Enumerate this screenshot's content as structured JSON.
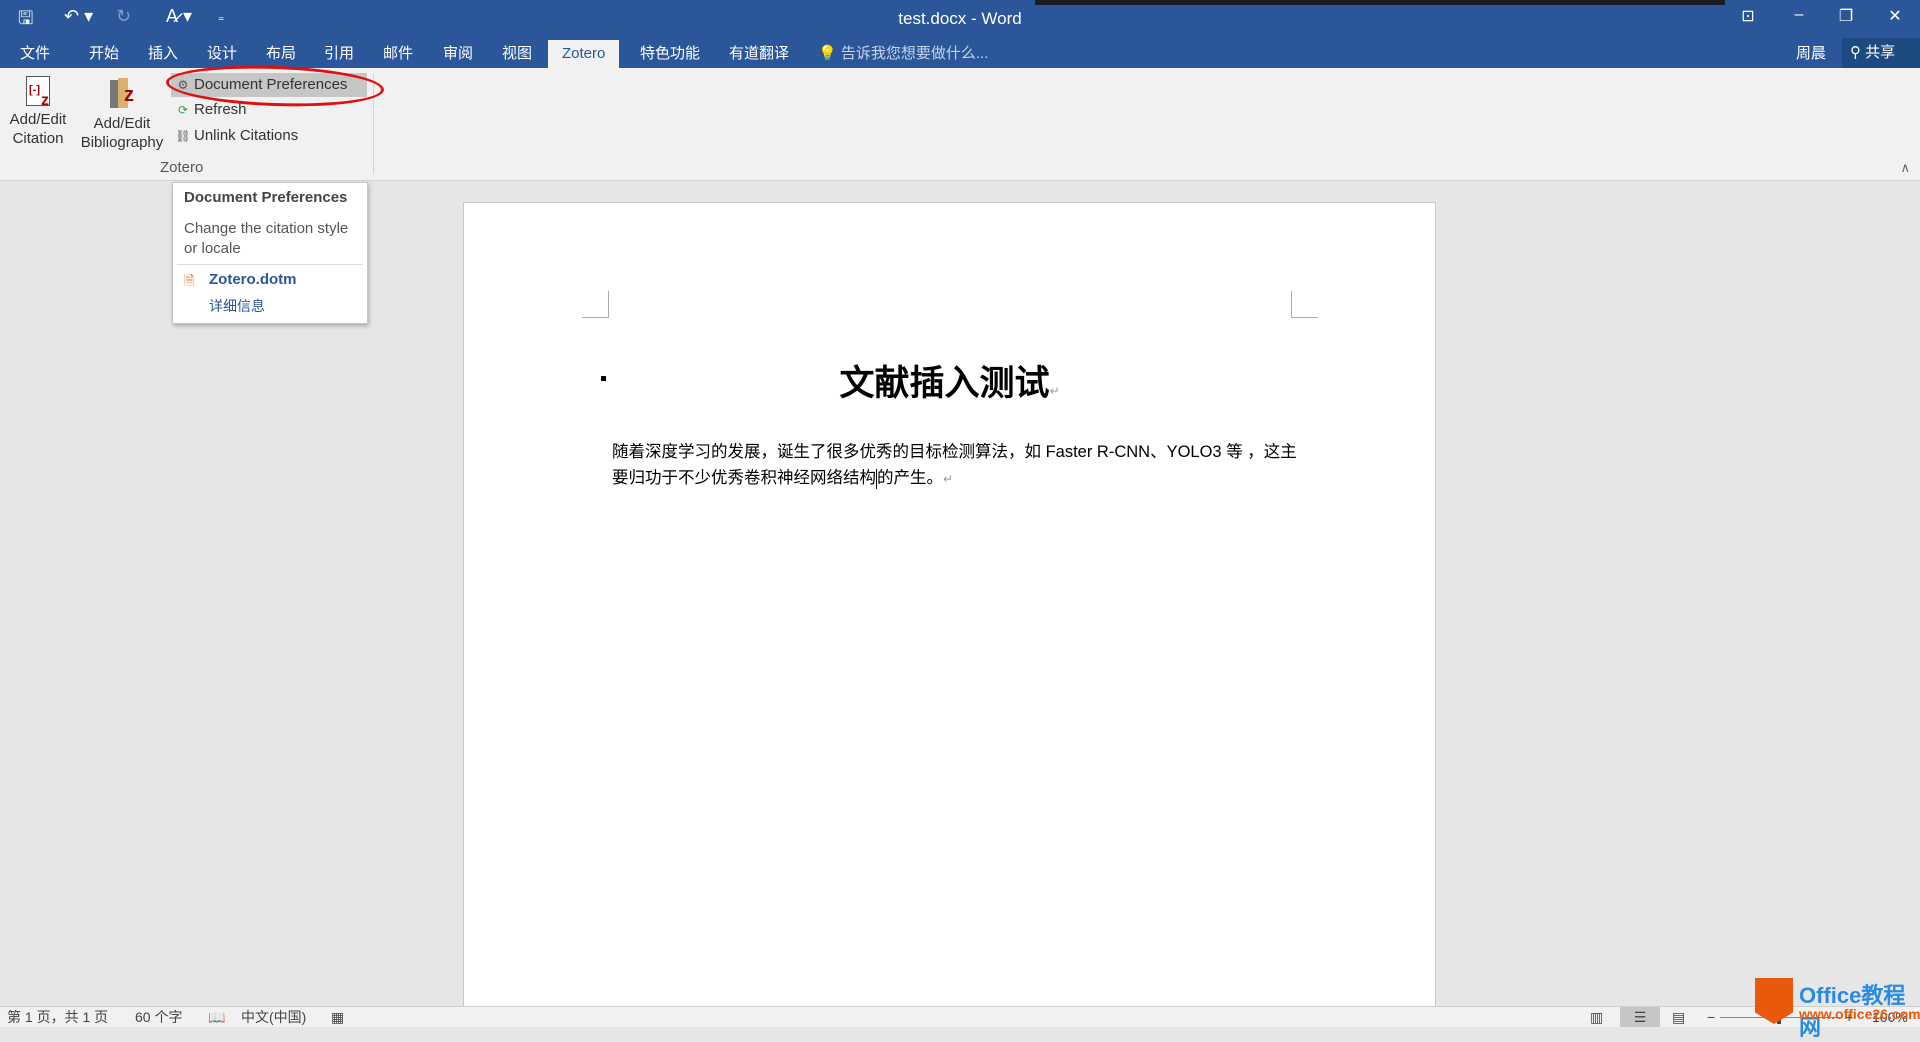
{
  "window": {
    "title": "test.docx - Word"
  },
  "quick_access": {
    "save_icon": "save-icon",
    "undo_icon": "undo-icon",
    "redo_icon": "redo-icon",
    "format_icon": "spelling-icon",
    "customize_icon": "customize-icon"
  },
  "tabs": [
    {
      "label": "文件"
    },
    {
      "label": "开始"
    },
    {
      "label": "插入"
    },
    {
      "label": "设计"
    },
    {
      "label": "布局"
    },
    {
      "label": "引用"
    },
    {
      "label": "邮件"
    },
    {
      "label": "审阅"
    },
    {
      "label": "视图"
    },
    {
      "label": "Zotero",
      "active": true
    },
    {
      "label": "特色功能"
    },
    {
      "label": "有道翻译"
    }
  ],
  "tell_me": "告诉我您想要做什么...",
  "user": "周晨",
  "share": "共享",
  "ribbon": {
    "add_edit_citation": "Add/Edit\nCitation",
    "add_edit_citation_l1": "Add/Edit",
    "add_edit_citation_l2": "Citation",
    "add_edit_bibliography_l1": "Add/Edit",
    "add_edit_bibliography_l2": "Bibliography",
    "document_preferences": "Document Preferences",
    "refresh": "Refresh",
    "unlink_citations": "Unlink Citations",
    "group_label": "Zotero"
  },
  "tooltip": {
    "title": "Document Preferences",
    "description": "Change the citation style or locale",
    "file": "Zotero.dotm",
    "more_info": "详细信息"
  },
  "document": {
    "title": "文献插入测试",
    "body_before_caret": "随着深度学习的发展，诞生了很多优秀的目标检测算法，如 Faster R-CNN、YOLO3 等 ，这主要归功于不少优秀卷积神经网络结构",
    "body_after_caret": "的产生。",
    "paragraph_mark": "↵"
  },
  "status": {
    "page": "第 1 页，共 1 页",
    "words": "60 个字",
    "language": "中文(中国)",
    "zoom": "100%"
  },
  "watermark": {
    "line1": "Office教程网",
    "line2": "www.office26.com"
  },
  "colors": {
    "brand": "#2b579a",
    "annotation": "#e01010"
  }
}
